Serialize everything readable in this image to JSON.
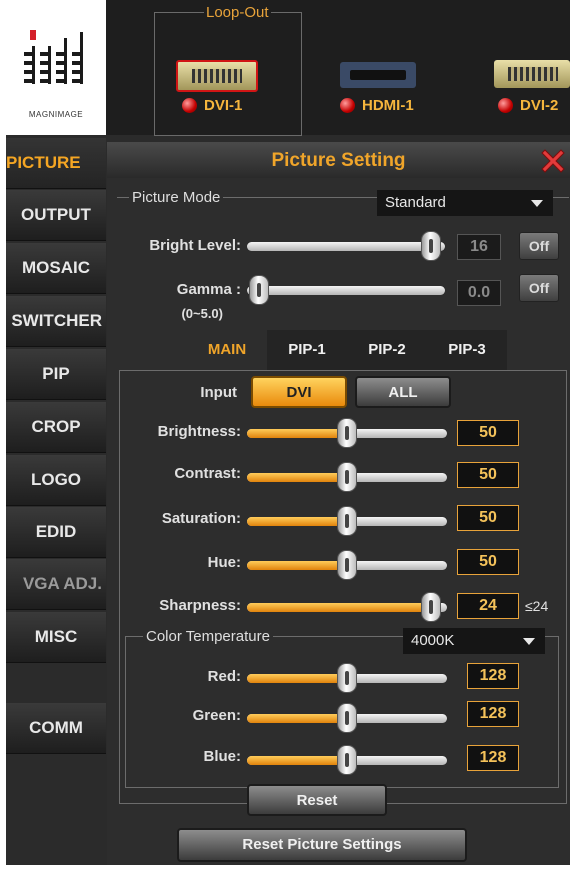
{
  "brand": {
    "logo_text": "MAGNIMAGE"
  },
  "loop_out": {
    "label": "Loop-Out",
    "ports": [
      {
        "label": "DVI-1",
        "connector": "dvi-port-icon"
      },
      {
        "label": "HDMI-1",
        "connector": "hdmi-port-icon"
      },
      {
        "label": "DVI-2",
        "connector": "dvi-port-icon"
      }
    ]
  },
  "sidebar": {
    "items": [
      {
        "label": "PICTURE"
      },
      {
        "label": "OUTPUT"
      },
      {
        "label": "MOSAIC"
      },
      {
        "label": "SWITCHER"
      },
      {
        "label": "PIP"
      },
      {
        "label": "CROP"
      },
      {
        "label": "LOGO"
      },
      {
        "label": "EDID"
      },
      {
        "label": "VGA ADJ."
      },
      {
        "label": "MISC"
      },
      {
        "label": "COMM"
      }
    ]
  },
  "panel": {
    "title": "Picture Setting",
    "picture_mode": {
      "label": "Picture Mode",
      "value": "Standard"
    },
    "bright_level": {
      "label": "Bright Level:",
      "value": "16",
      "button": "Off",
      "level": 0.82
    },
    "gamma": {
      "label": "Gamma :",
      "range": "(0~5.0)",
      "value": "0.0",
      "button": "Off",
      "level": 0.0
    },
    "tabs": [
      "MAIN",
      "PIP-1",
      "PIP-2",
      "PIP-3"
    ],
    "input": {
      "label": "Input",
      "options": [
        "DVI",
        "ALL"
      ],
      "selected": "DVI"
    },
    "adjust": [
      {
        "label": "Brightness:",
        "value": "50",
        "level": 0.5
      },
      {
        "label": "Contrast:",
        "value": "50",
        "level": 0.5
      },
      {
        "label": "Saturation:",
        "value": "50",
        "level": 0.5
      },
      {
        "label": "Hue:",
        "value": "50",
        "level": 0.5
      },
      {
        "label": "Sharpness:",
        "value": "24",
        "level": 1.0,
        "suffix": "≤24"
      }
    ],
    "color_temperature": {
      "label": "Color Temperature",
      "value": "4000K",
      "channels": [
        {
          "label": "Red:",
          "value": "128",
          "level": 0.5
        },
        {
          "label": "Green:",
          "value": "128",
          "level": 0.5
        },
        {
          "label": "Blue:",
          "value": "128",
          "level": 0.5
        }
      ]
    },
    "reset_label": "Reset",
    "reset_all_label": "Reset Picture Settings"
  },
  "colors": {
    "accent": "#f0a52a",
    "led": "#d40000",
    "panel_bg": "#2d2d2d"
  }
}
